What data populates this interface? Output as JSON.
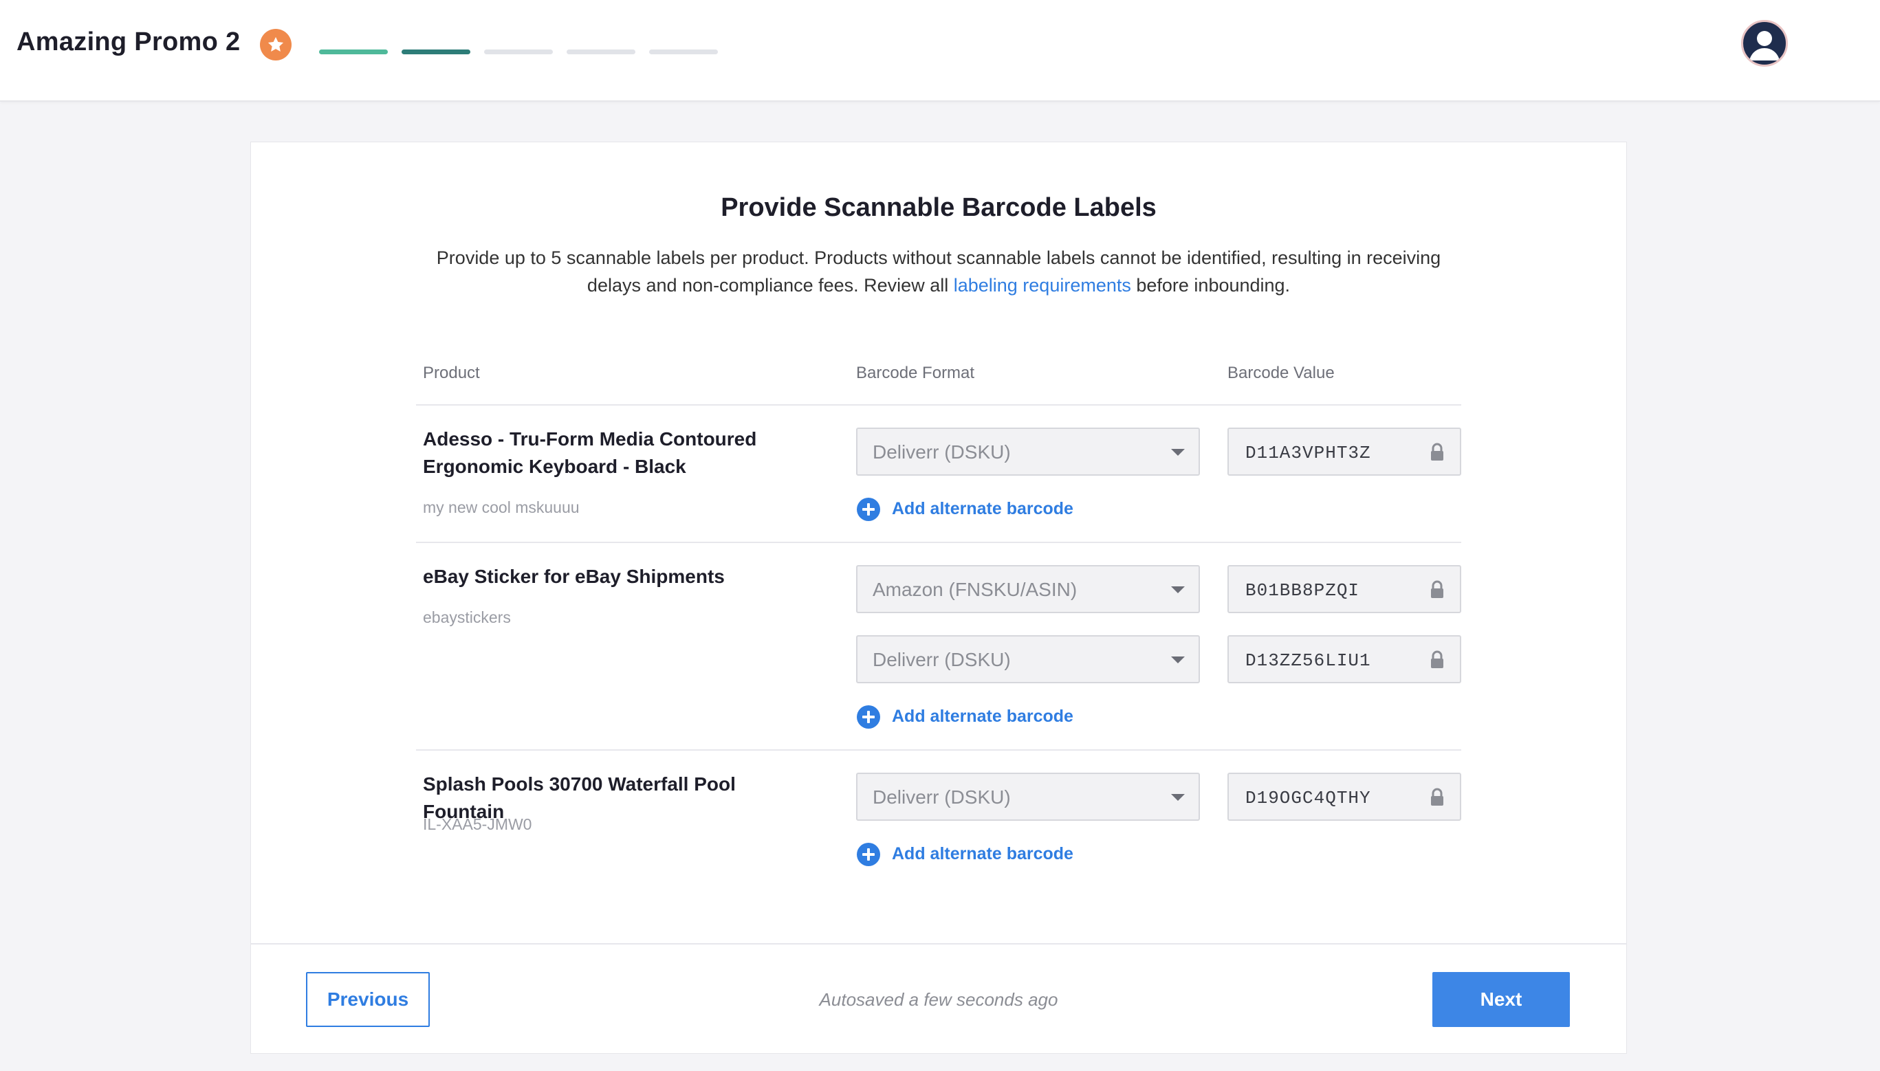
{
  "header": {
    "title": "Amazing Promo 2",
    "badge_icon": "star-icon",
    "badge_color": "#f08a4b",
    "progress_steps": [
      {
        "state": "complete",
        "color": "#4fb99a"
      },
      {
        "state": "current",
        "color": "#2d7d78"
      },
      {
        "state": "upcoming",
        "color": "#e1e3e8"
      },
      {
        "state": "upcoming",
        "color": "#e1e3e8"
      },
      {
        "state": "upcoming",
        "color": "#e1e3e8"
      }
    ],
    "avatar_icon": "user-avatar-icon"
  },
  "card": {
    "title": "Provide Scannable Barcode Labels",
    "description_before": "Provide up to 5 scannable labels per product. Products without scannable labels cannot be identified, resulting in receiving delays and non-compliance fees. Review all ",
    "description_link": "labeling requirements",
    "description_after": " before inbounding.",
    "columns": {
      "product": "Product",
      "format": "Barcode Format",
      "value": "Barcode Value"
    },
    "products": [
      {
        "name": "Adesso - Tru-Form Media Contoured Ergonomic Keyboard - Black",
        "sku": "my new cool mskuuuu",
        "barcodes": [
          {
            "format": "Deliverr (DSKU)",
            "value": "D11A3VPHT3Z"
          }
        ],
        "add_label": "Add alternate barcode"
      },
      {
        "name": "eBay Sticker for eBay Shipments",
        "sku": "ebaystickers",
        "barcodes": [
          {
            "format": "Amazon (FNSKU/ASIN)",
            "value": "B01BB8PZQI"
          },
          {
            "format": "Deliverr (DSKU)",
            "value": "D13ZZ56LIU1"
          }
        ],
        "add_label": "Add alternate barcode"
      },
      {
        "name": "Splash Pools 30700 Waterfall Pool Fountain",
        "sku": "IL-XAA5-JMW0",
        "barcodes": [
          {
            "format": "Deliverr (DSKU)",
            "value": "D19OGC4QTHY"
          }
        ],
        "add_label": "Add alternate barcode"
      }
    ]
  },
  "footer": {
    "previous_label": "Previous",
    "autosave_text": "Autosaved a few seconds ago",
    "next_label": "Next"
  },
  "colors": {
    "accent": "#2f7de1",
    "primary_button": "#3d86e6"
  }
}
